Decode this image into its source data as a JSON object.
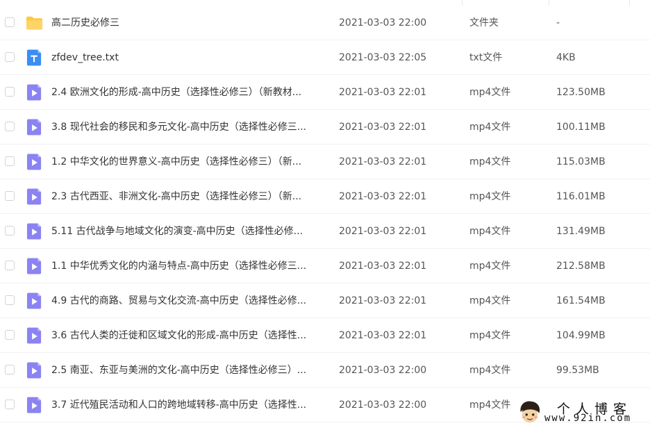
{
  "files": [
    {
      "name": "高二历史必修三",
      "date": "2021-03-03 22:00",
      "type": "文件夹",
      "size": "-",
      "icon": "folder-icon"
    },
    {
      "name": "zfdev_tree.txt",
      "date": "2021-03-03 22:05",
      "type": "txt文件",
      "size": "4KB",
      "icon": "text-file-icon"
    },
    {
      "name": "2.4 欧洲文化的形成-高中历史（选择性必修三）（新教材...",
      "date": "2021-03-03 22:01",
      "type": "mp4文件",
      "size": "123.50MB",
      "icon": "video-file-icon"
    },
    {
      "name": "3.8 现代社会的移民和多元文化-高中历史（选择性必修三...",
      "date": "2021-03-03 22:01",
      "type": "mp4文件",
      "size": "100.11MB",
      "icon": "video-file-icon"
    },
    {
      "name": "1.2 中华文化的世界意义-高中历史（选择性必修三）（新...",
      "date": "2021-03-03 22:01",
      "type": "mp4文件",
      "size": "115.03MB",
      "icon": "video-file-icon"
    },
    {
      "name": "2.3 古代西亚、非洲文化-高中历史（选择性必修三）（新...",
      "date": "2021-03-03 22:01",
      "type": "mp4文件",
      "size": "116.01MB",
      "icon": "video-file-icon"
    },
    {
      "name": "5.11 古代战争与地域文化的演变-高中历史（选择性必修...",
      "date": "2021-03-03 22:01",
      "type": "mp4文件",
      "size": "131.49MB",
      "icon": "video-file-icon"
    },
    {
      "name": "1.1 中华优秀文化的内涵与特点-高中历史（选择性必修三...",
      "date": "2021-03-03 22:01",
      "type": "mp4文件",
      "size": "212.58MB",
      "icon": "video-file-icon"
    },
    {
      "name": "4.9 古代的商路、贸易与文化交流-高中历史（选择性必修...",
      "date": "2021-03-03 22:01",
      "type": "mp4文件",
      "size": "161.54MB",
      "icon": "video-file-icon"
    },
    {
      "name": "3.6 古代人类的迁徙和区域文化的形成-高中历史（选择性...",
      "date": "2021-03-03 22:01",
      "type": "mp4文件",
      "size": "104.99MB",
      "icon": "video-file-icon"
    },
    {
      "name": "2.5 南亚、东亚与美洲的文化-高中历史（选择性必修三）...",
      "date": "2021-03-03 22:00",
      "type": "mp4文件",
      "size": "99.53MB",
      "icon": "video-file-icon"
    },
    {
      "name": "3.7 近代殖民活动和人口的跨地域转移-高中历史（选择性...",
      "date": "2021-03-03 22:00",
      "type": "mp4文件",
      "size": "",
      "icon": "video-file-icon"
    }
  ],
  "watermark": {
    "title": "个人博客",
    "url": "www.92in.com"
  },
  "colors": {
    "folder": "#FFC940",
    "text_file": "#3A8DF5",
    "video_file": "#8B83F2"
  }
}
